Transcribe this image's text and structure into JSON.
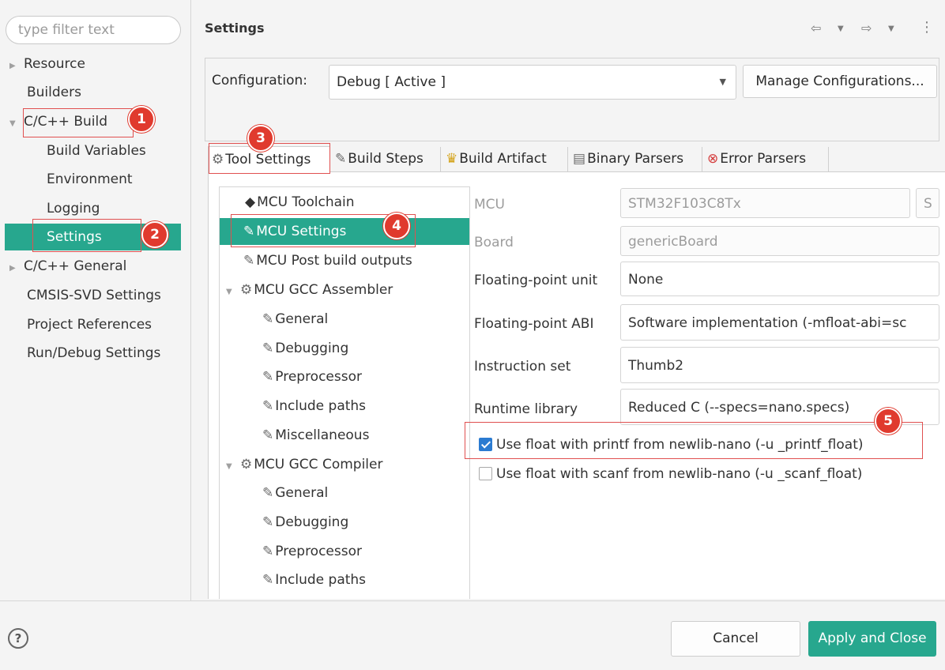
{
  "filter": {
    "placeholder": "type filter text"
  },
  "nav": [
    {
      "label": "Resource"
    },
    {
      "label": "Builders"
    },
    {
      "label": "C/C++ Build"
    },
    {
      "label": "Build Variables"
    },
    {
      "label": "Environment"
    },
    {
      "label": "Logging"
    },
    {
      "label": "Settings"
    },
    {
      "label": "C/C++ General"
    },
    {
      "label": "CMSIS-SVD Settings"
    },
    {
      "label": "Project References"
    },
    {
      "label": "Run/Debug Settings"
    }
  ],
  "header": {
    "title": "Settings"
  },
  "config": {
    "label": "Configuration:",
    "value": "Debug  [ Active ]",
    "manage_label": "Manage Configurations..."
  },
  "tabs": [
    {
      "label": "Tool Settings"
    },
    {
      "label": "Build Steps"
    },
    {
      "label": "Build Artifact"
    },
    {
      "label": "Binary Parsers"
    },
    {
      "label": "Error Parsers"
    }
  ],
  "tree": [
    {
      "label": "MCU Toolchain"
    },
    {
      "label": "MCU Settings"
    },
    {
      "label": "MCU Post build outputs"
    },
    {
      "label": "MCU GCC Assembler"
    },
    {
      "label": "General"
    },
    {
      "label": "Debugging"
    },
    {
      "label": "Preprocessor"
    },
    {
      "label": "Include paths"
    },
    {
      "label": "Miscellaneous"
    },
    {
      "label": "MCU GCC Compiler"
    },
    {
      "label": "General"
    },
    {
      "label": "Debugging"
    },
    {
      "label": "Preprocessor"
    },
    {
      "label": "Include paths"
    }
  ],
  "form": {
    "mcu_label": "MCU",
    "mcu_value": "STM32F103C8Tx",
    "mcu_extra": "S",
    "board_label": "Board",
    "board_value": "genericBoard",
    "fpu_label": "Floating-point unit",
    "fpu_value": "None",
    "abi_label": "Floating-point ABI",
    "abi_value": "Software implementation (-mfloat-abi=sc",
    "iset_label": "Instruction set",
    "iset_value": "Thumb2",
    "runtime_label": "Runtime library",
    "runtime_value": "Reduced C (--specs=nano.specs)",
    "printf_label": "Use float with printf from newlib-nano (-u _printf_float)",
    "printf_checked": true,
    "scanf_label": "Use float with scanf from newlib-nano (-u _scanf_float)",
    "scanf_checked": false
  },
  "badges": [
    "1",
    "2",
    "3",
    "4",
    "5"
  ],
  "buttons": {
    "cancel": "Cancel",
    "apply": "Apply and Close",
    "help": "?"
  },
  "colors": {
    "accent": "#27a78e",
    "annotation": "#e03a2e"
  }
}
